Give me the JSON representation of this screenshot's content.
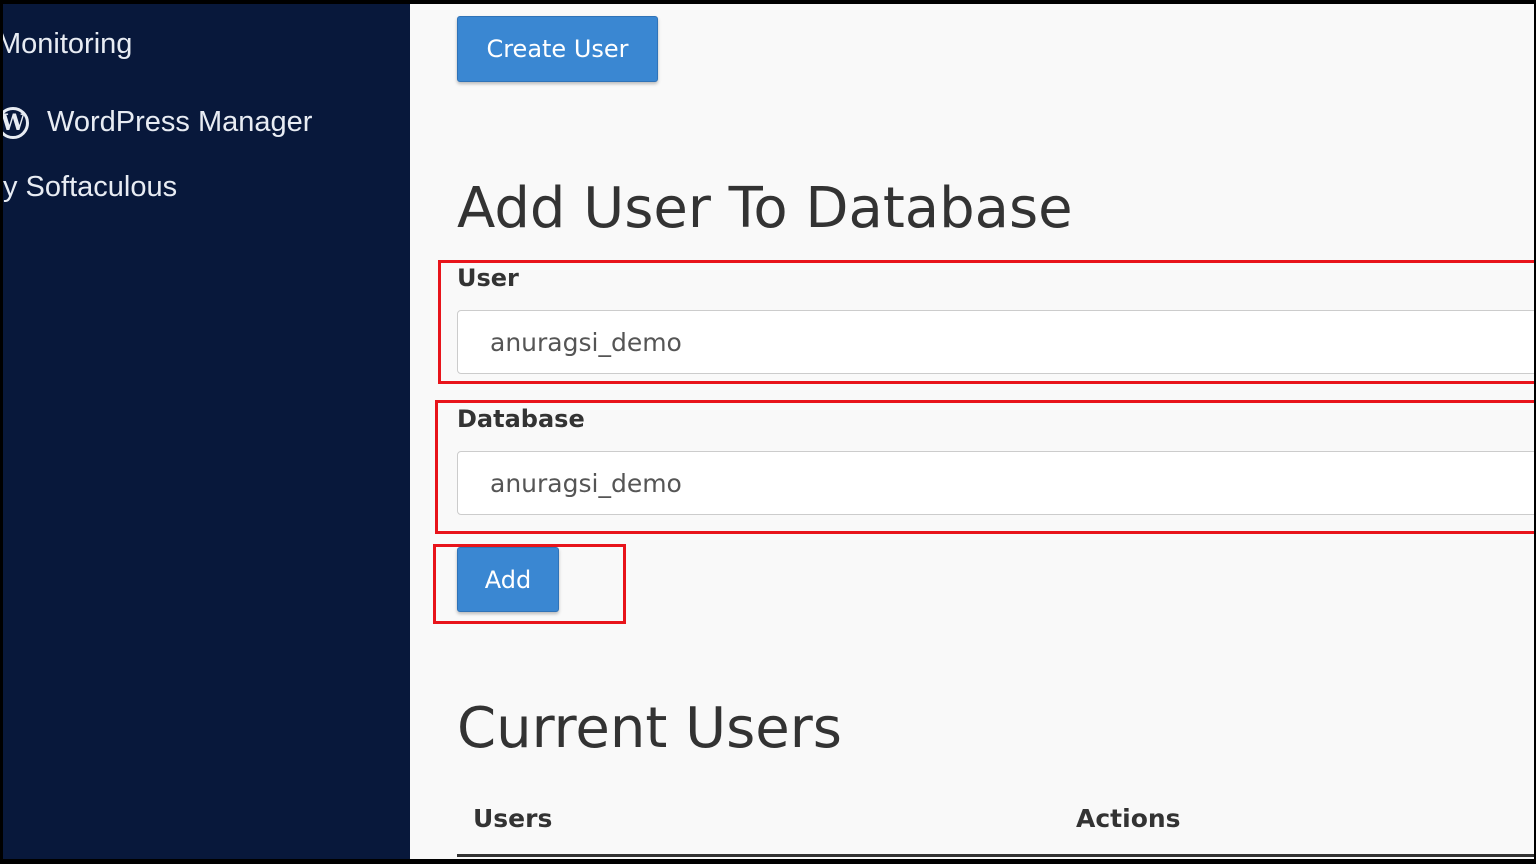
{
  "sidebar": {
    "items": [
      {
        "label": "Monitoring"
      },
      {
        "label": "WordPress Manager",
        "icon": "wordpress-icon"
      },
      {
        "label": "y Softaculous"
      }
    ]
  },
  "main": {
    "create_user_label": "Create User",
    "add_user_heading": "Add User To Database",
    "user_label": "User",
    "user_value": "anuragsi_demo",
    "database_label": "Database",
    "database_value": "anuragsi_demo",
    "add_label": "Add",
    "current_users_heading": "Current Users",
    "table": {
      "columns": [
        "Users",
        "Actions"
      ]
    }
  },
  "colors": {
    "sidebar": "#08183b",
    "button": "#3a87d2",
    "highlight": "#e8141b"
  }
}
